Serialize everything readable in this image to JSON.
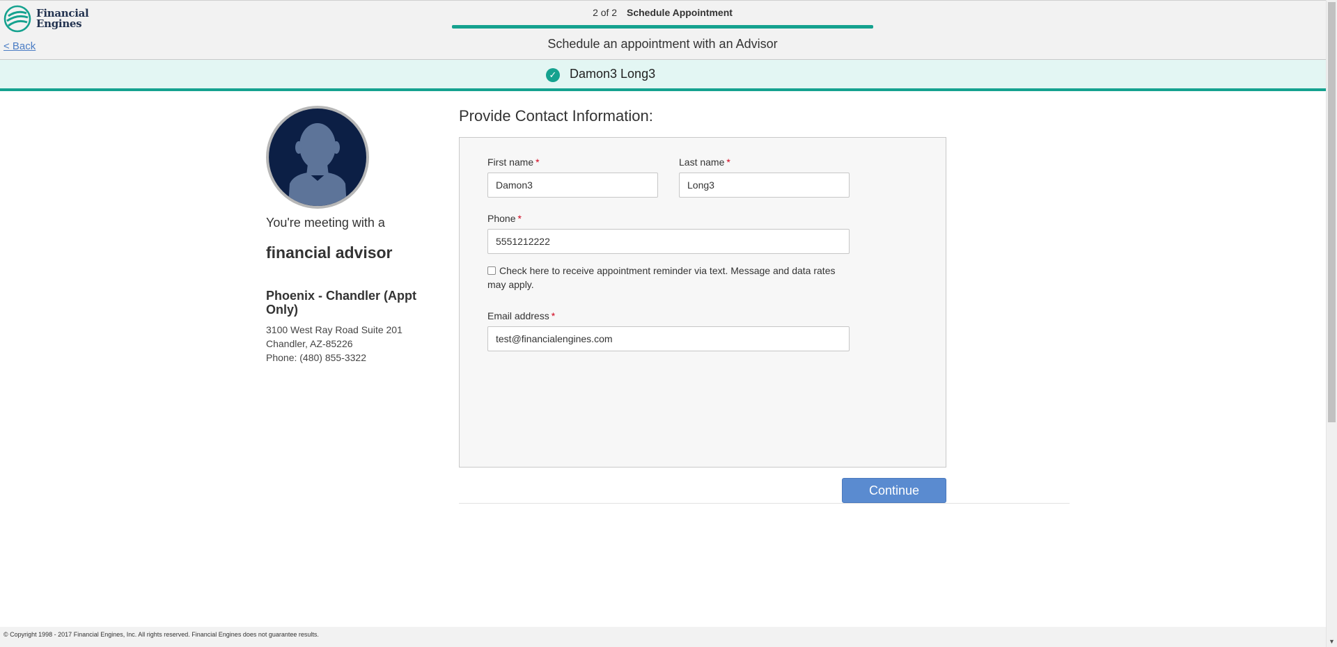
{
  "brand": {
    "line1": "Financial",
    "line2": "Engines",
    "color": "#233350",
    "accent": "#15a28f"
  },
  "nav": {
    "back_label": "< Back"
  },
  "progress": {
    "count": "2 of 2",
    "step_name": "Schedule Appointment",
    "subtitle": "Schedule an appointment with an Advisor",
    "fraction": 1.0
  },
  "user": {
    "full_name": "Damon3 Long3",
    "status_icon": "check-circle-icon"
  },
  "advisor": {
    "meeting_text": "You're meeting with a",
    "title": "financial advisor",
    "office_name": "Phoenix - Chandler (Appt Only)",
    "address_line1": "3100 West Ray Road Suite 201",
    "address_line2": "Chandler, AZ-85226",
    "phone": "Phone: (480) 855-3322"
  },
  "form": {
    "heading": "Provide Contact Information:",
    "first_name": {
      "label": "First name",
      "value": "Damon3"
    },
    "last_name": {
      "label": "Last name",
      "value": "Long3"
    },
    "phone": {
      "label": "Phone",
      "value": "5551212222"
    },
    "sms_opt_in": {
      "label": "Check here to receive appointment reminder via text. Message and data rates may apply.",
      "checked": false
    },
    "email": {
      "label": "Email address",
      "value": "test@financialengines.com"
    },
    "required_mark": "*",
    "continue_label": "Continue"
  },
  "footer": {
    "copyright": "© Copyright 1998 - 2017 Financial Engines, Inc. All rights reserved. Financial Engines does not guarantee results."
  }
}
